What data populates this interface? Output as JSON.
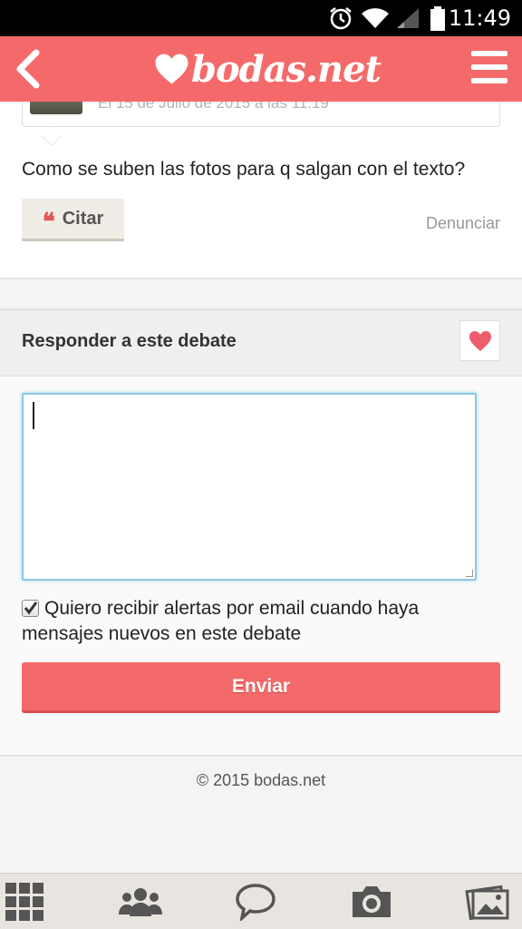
{
  "status_bar": {
    "time": "11:49"
  },
  "header": {
    "brand": "bodas.net"
  },
  "post": {
    "date": "El 15 de Julio de 2015 a las 11:19",
    "text": "Como se suben las fotos para q salgan con el texto?",
    "quote_label": "Citar",
    "report_label": "Denunciar"
  },
  "reply": {
    "title": "Responder a este debate",
    "input_value": "",
    "alert_label": "Quiero recibir alertas por email cuando haya mensajes nuevos en este debate",
    "alert_checked": true,
    "send_label": "Enviar"
  },
  "footer": {
    "copyright": "© 2015 bodas.net"
  },
  "bottom_nav": {
    "items": [
      "grid-icon",
      "community-icon",
      "chat-icon",
      "camera-icon",
      "gallery-icon"
    ]
  },
  "colors": {
    "accent": "#f46a6a",
    "status_bar": "#000000",
    "nav_bg": "#e8e4df"
  }
}
